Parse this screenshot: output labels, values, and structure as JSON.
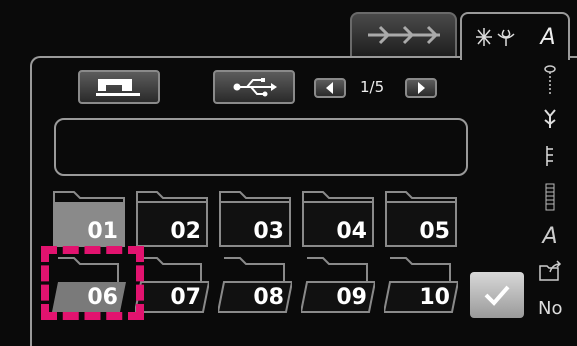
{
  "tabs": [
    {
      "label": "→→→",
      "icon": "stitch-arrows-icon",
      "active": false
    },
    {
      "label": "A",
      "icon": "decorative-stitch-icon",
      "active": true
    }
  ],
  "toolbar": {
    "page_indicator": "1/5"
  },
  "folders": [
    {
      "label": "01"
    },
    {
      "label": "02"
    },
    {
      "label": "03"
    },
    {
      "label": "04"
    },
    {
      "label": "05"
    },
    {
      "label": "06"
    },
    {
      "label": "07"
    },
    {
      "label": "08"
    },
    {
      "label": "09"
    },
    {
      "label": "10"
    }
  ],
  "sidebar": {
    "font_label": "A",
    "no_label": "No"
  },
  "colors": {
    "selection": "#e2136f"
  }
}
